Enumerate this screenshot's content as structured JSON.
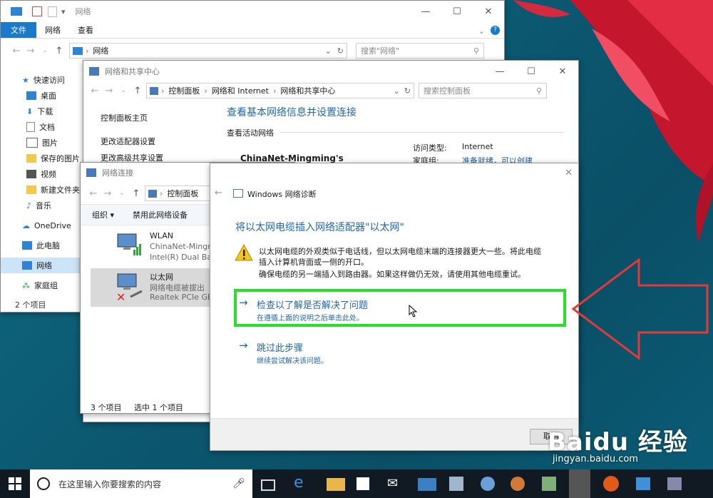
{
  "explorer": {
    "title": "网络",
    "ribbon_tabs": [
      "文件",
      "网络",
      "查看"
    ],
    "address": "网络",
    "search_placeholder": "搜索\"网络\"",
    "nav": [
      "快速访问",
      "桌面",
      "下载",
      "文档",
      "图片",
      "保存的图片",
      "视频",
      "新建文件夹",
      "音乐",
      "OneDrive",
      "此电脑",
      "网络",
      "家庭组"
    ],
    "status": "2 个项目"
  },
  "nsc": {
    "title": "网络和共享中心",
    "breadcrumb": [
      "控制面板",
      "网络和 Internet",
      "网络和共享中心"
    ],
    "search_placeholder": "搜索控制面板",
    "left_links": [
      "控制面板主页",
      "更改适配器设置",
      "更改高级共享设置"
    ],
    "heading": "查看基本网络信息并设置连接",
    "section": "查看活动网络",
    "network_name": "ChinaNet-Mingming's",
    "access_type_label": "访问类型:",
    "access_type_value": "Internet",
    "homegroup_label": "家庭组:",
    "homegroup_value": "准备就绪，可以创建"
  },
  "netconn": {
    "title": "网络连接",
    "breadcrumb": "控制面板",
    "toolbar": [
      "组织 ▾",
      "禁用此网络设备"
    ],
    "items": [
      {
        "name": "WLAN",
        "line1": "ChinaNet-Mingm",
        "line2": "Intel(R) Dual Ban"
      },
      {
        "name": "以太网",
        "line1": "网络电缆被拔出",
        "line2": "Realtek PCIe GB"
      }
    ],
    "status_count": "3 个项目",
    "status_selected": "选中 1 个项目"
  },
  "diag": {
    "title": "Windows 网络诊断",
    "heading": "将以太网电缆插入网络适配器\"以太网\"",
    "message1": "以太网电缆的外观类似于电话线，但以太网电缆末端的连接器更大一些。将此电缆插入计算机背面或一侧的开口。",
    "message2": "确保电缆的另一端插入到路由器。如果这样做仍无效，请使用其他电缆重试。",
    "option1_title": "检查以了解是否解决了问题",
    "option1_sub": "在遵循上面的说明之后单击此处。",
    "option2_title": "跳过此步骤",
    "option2_sub": "继续尝试解决该问题。",
    "cancel": "取消"
  },
  "taskbar": {
    "search_placeholder": "在这里输入你要搜索的内容"
  },
  "watermark": {
    "brand": "Baidu 经验",
    "url": "jingyan.baidu.com"
  },
  "colors": {
    "accent": "#1979ca",
    "highlight_box": "#28e028",
    "arrow": "#e03a3a"
  }
}
